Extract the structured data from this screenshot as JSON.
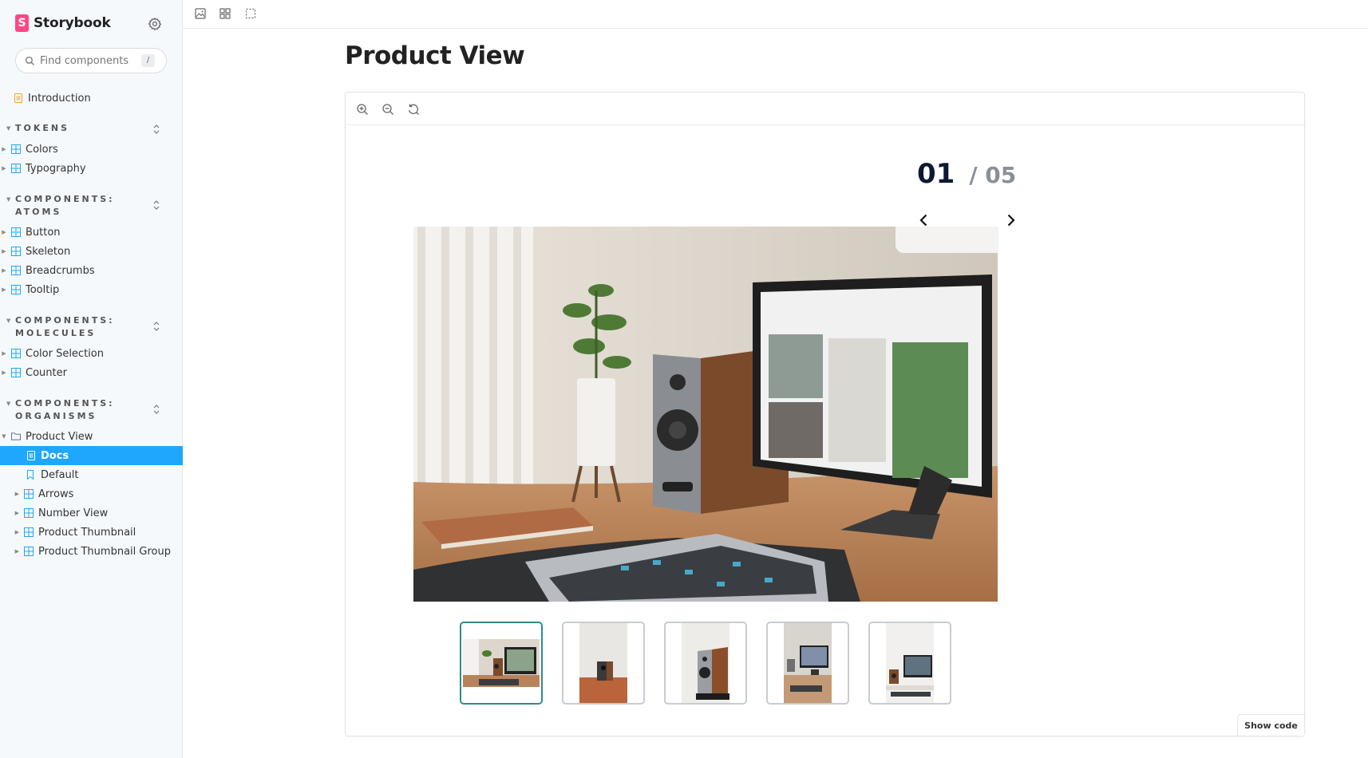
{
  "app": {
    "name": "Storybook",
    "logo_letter": "S",
    "brand_color": "#ff4785",
    "accent_color": "#1ea7fd"
  },
  "search": {
    "placeholder": "Find components",
    "shortcut": "/"
  },
  "sidebar": {
    "introduction": "Introduction",
    "sections": [
      {
        "title": "TOKENS",
        "items": [
          "Colors",
          "Typography"
        ]
      },
      {
        "title": "COMPONENTS: ATOMS",
        "items": [
          "Button",
          "Skeleton",
          "Breadcrumbs",
          "Tooltip"
        ]
      },
      {
        "title": "COMPONENTS: MOLECULES",
        "items": [
          "Color Selection",
          "Counter"
        ]
      },
      {
        "title": "COMPONENTS: ORGANISMS",
        "items": [
          "Product View"
        ]
      }
    ],
    "product_view_children": [
      "Docs",
      "Default",
      "Arrows",
      "Number View",
      "Product Thumbnail",
      "Product Thumbnail Group"
    ]
  },
  "toolbar": {
    "icons": [
      "image-icon",
      "grid-icon",
      "outline-icon"
    ]
  },
  "page": {
    "title": "Product View"
  },
  "preview": {
    "zoom_icons": [
      "zoom-in-icon",
      "zoom-out-icon",
      "zoom-reset-icon"
    ],
    "counter_current": "01",
    "counter_total": "/ 05",
    "show_code": "Show code",
    "thumbnail_count": 5,
    "selected_thumbnail": 1,
    "selected_color": "#2e8b8b"
  }
}
